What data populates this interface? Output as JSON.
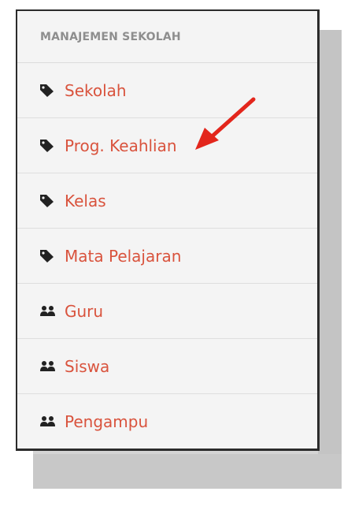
{
  "menu": {
    "header": "MANAJEMEN SEKOLAH",
    "items": [
      {
        "label": "Sekolah",
        "icon": "tag-icon"
      },
      {
        "label": "Prog. Keahlian",
        "icon": "tag-icon"
      },
      {
        "label": "Kelas",
        "icon": "tag-icon"
      },
      {
        "label": "Mata Pelajaran",
        "icon": "tag-icon"
      },
      {
        "label": "Guru",
        "icon": "users-icon"
      },
      {
        "label": "Siswa",
        "icon": "users-icon"
      },
      {
        "label": "Pengampu",
        "icon": "users-icon"
      }
    ]
  },
  "colors": {
    "link": "#d9533d",
    "header_text": "#8e8e8e",
    "icon": "#222222",
    "arrow": "#e3261c"
  },
  "annotation": {
    "icon": "red-arrow",
    "points_to": "Prog. Keahlian"
  }
}
